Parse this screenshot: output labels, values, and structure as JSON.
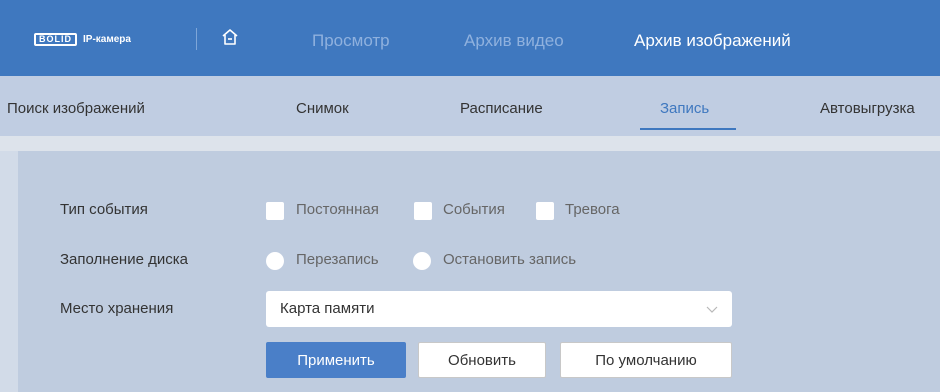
{
  "header": {
    "logo_brand": "BOLID",
    "logo_text": "IP-камера",
    "nav": [
      {
        "label": "Просмотр",
        "active": false
      },
      {
        "label": "Архив видео",
        "active": false
      },
      {
        "label": "Архив изображений",
        "active": true
      }
    ]
  },
  "subnav": {
    "tabs": [
      {
        "label": "Поиск изображений",
        "active": false
      },
      {
        "label": "Снимок",
        "active": false
      },
      {
        "label": "Расписание",
        "active": false
      },
      {
        "label": "Запись",
        "active": true
      },
      {
        "label": "Автовыгрузка",
        "active": false
      }
    ]
  },
  "form": {
    "event_type": {
      "label": "Тип события",
      "options": [
        {
          "label": "Постоянная",
          "checked": false
        },
        {
          "label": "События",
          "checked": false
        },
        {
          "label": "Тревога",
          "checked": false
        }
      ]
    },
    "disk_full": {
      "label": "Заполнение диска",
      "options": [
        {
          "label": "Перезапись",
          "selected": false
        },
        {
          "label": "Остановить запись",
          "selected": false
        }
      ]
    },
    "storage": {
      "label": "Место хранения",
      "value": "Карта памяти"
    }
  },
  "buttons": {
    "apply": "Применить",
    "refresh": "Обновить",
    "default": "По умолчанию"
  },
  "colors": {
    "header_bg": "#3f78bf",
    "accent": "#3f78bf",
    "primary_button": "#4a7fc8",
    "panel_bg": "#bfccdf"
  }
}
